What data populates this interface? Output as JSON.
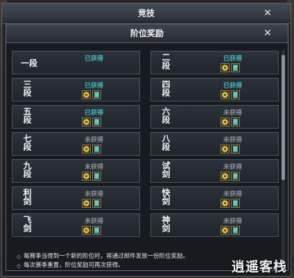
{
  "outer": {
    "title": "竞技"
  },
  "inner": {
    "title": "阶位奖励"
  },
  "tiers": [
    {
      "name": "一段",
      "status": "已获得",
      "obtained": true,
      "rewards": []
    },
    {
      "name": "二段",
      "status": "已获得",
      "obtained": true,
      "rewards": [
        "coin-icon",
        "ticket-icon"
      ]
    },
    {
      "name": "三段",
      "status": "已获得",
      "obtained": true,
      "rewards": [
        "coin-icon",
        "ticket-icon"
      ]
    },
    {
      "name": "四段",
      "status": "已获得",
      "obtained": true,
      "rewards": [
        "coin-icon",
        "ticket-icon"
      ]
    },
    {
      "name": "五段",
      "status": "已获得",
      "obtained": true,
      "rewards": [
        "coin-icon",
        "ticket-icon"
      ]
    },
    {
      "name": "六段",
      "status": "未获得",
      "obtained": false,
      "rewards": [
        "coin-icon",
        "ticket-icon"
      ]
    },
    {
      "name": "七段",
      "status": "未获得",
      "obtained": false,
      "rewards": [
        "coin-icon",
        "ticket-icon"
      ]
    },
    {
      "name": "八段",
      "status": "未获得",
      "obtained": false,
      "rewards": [
        "coin-icon",
        "ticket-icon"
      ]
    },
    {
      "name": "九段",
      "status": "未获得",
      "obtained": false,
      "rewards": [
        "coin-icon",
        "ticket-icon"
      ]
    },
    {
      "name": "试剑",
      "status": "未获得",
      "obtained": false,
      "rewards": [
        "coin-icon",
        "ticket-icon"
      ]
    },
    {
      "name": "利剑",
      "status": "未获得",
      "obtained": false,
      "rewards": [
        "coin-icon",
        "ticket-icon"
      ]
    },
    {
      "name": "快剑",
      "status": "未获得",
      "obtained": false,
      "rewards": [
        "coin-icon",
        "ticket-icon"
      ]
    },
    {
      "name": "飞剑",
      "status": "未获得",
      "obtained": false,
      "rewards": [
        "coin-icon",
        "ticket-icon"
      ]
    },
    {
      "name": "神剑",
      "status": "未获得",
      "obtained": false,
      "rewards": [
        "coin-icon",
        "ticket-icon"
      ]
    }
  ],
  "notes": [
    "每赛季当得到一个新的阶位时，将通过邮件发放一份阶位奖励。",
    "每次赛季重置，阶位奖励可再次获得。"
  ],
  "watermark": {
    "text": "逍遥客栈"
  },
  "colors": {
    "obtained": "#45b4ba",
    "locked": "#8a8e94",
    "coin": "#e0c04a",
    "ticket": "#3fa79a"
  }
}
